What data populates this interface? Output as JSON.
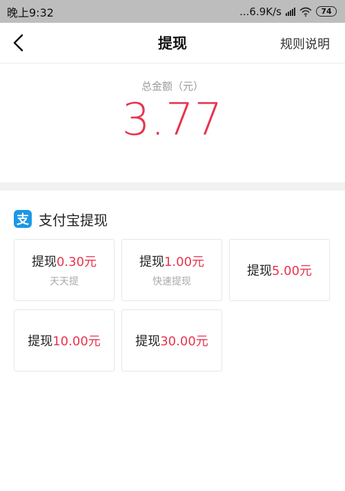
{
  "status_bar": {
    "time": "晚上9:32",
    "network_speed": "...6.9K/s",
    "battery": "74"
  },
  "header": {
    "title": "提现",
    "rules_label": "规则说明"
  },
  "balance": {
    "label": "总金额（元）",
    "amount": "3.77"
  },
  "alipay": {
    "icon_glyph": "支",
    "section_title": "支付宝提现",
    "options": [
      {
        "prefix": "提现",
        "amount": "0.30元",
        "sub": "天天提"
      },
      {
        "prefix": "提现",
        "amount": "1.00元",
        "sub": "快速提现"
      },
      {
        "prefix": "提现",
        "amount": "5.00元",
        "sub": ""
      },
      {
        "prefix": "提现",
        "amount": "10.00元",
        "sub": ""
      },
      {
        "prefix": "提现",
        "amount": "30.00元",
        "sub": ""
      }
    ]
  },
  "colors": {
    "accent": "#e8334f",
    "alipay_blue": "#1b98e6",
    "status_bar_bg": "#bdbdbd"
  }
}
